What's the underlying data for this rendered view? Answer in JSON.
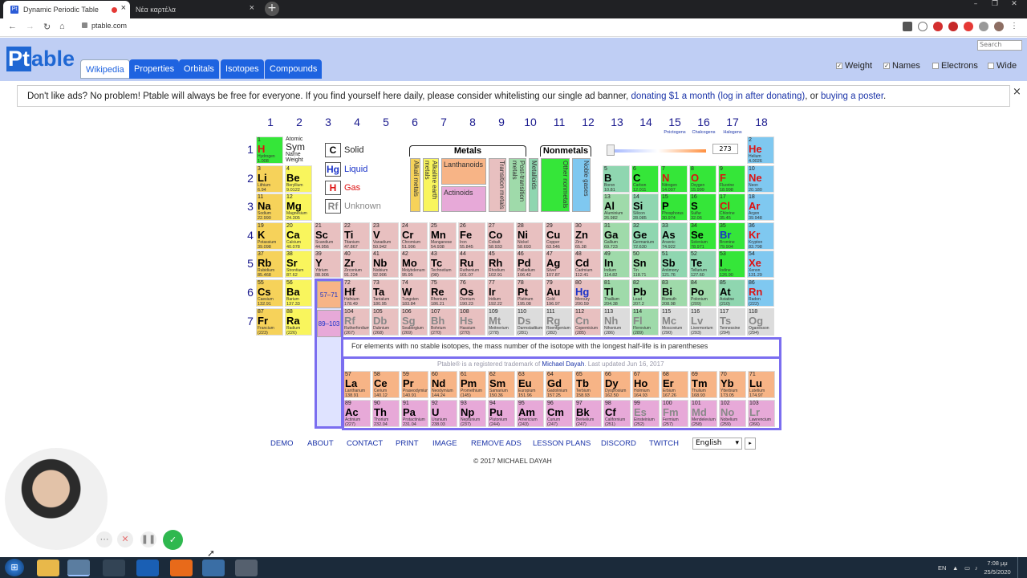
{
  "browser": {
    "tab_title": "Dynamic Periodic Table",
    "tab2_title": "Νέα καρτέλα",
    "url": "ptable.com",
    "tab_close": "×",
    "new_tab": "+"
  },
  "site": {
    "logo_pt": "Pt",
    "logo_rest": "able",
    "search_placeholder": "Search",
    "tabs": [
      "Wikipedia",
      "Properties",
      "Orbitals",
      "Isotopes",
      "Compounds"
    ],
    "options": [
      "Weight",
      "Names",
      "Electrons",
      "Wide"
    ],
    "ad_text": "Don't like ads? No problem! Ptable will always be free for everyone. If you find yourself here daily, please consider whitelisting our single ad banner, ",
    "ad_link1": "donating $1 a month",
    "ad_link2": "(log in after donating)",
    "ad_mid": ", or ",
    "ad_link3": "buying a poster",
    "ad_end": ".",
    "ad_close": "×"
  },
  "groups": [
    "1",
    "2",
    "3",
    "4",
    "5",
    "6",
    "7",
    "8",
    "9",
    "10",
    "11",
    "12",
    "13",
    "14",
    "15",
    "16",
    "17",
    "18"
  ],
  "group_sub": {
    "15": "Pnictogens",
    "16": "Chalcogens",
    "17": "Halogens"
  },
  "periods": [
    "1",
    "2",
    "3",
    "4",
    "5",
    "6",
    "7"
  ],
  "legend": {
    "atomic": "Atomic",
    "sym": "Sym",
    "name": "Name",
    "weight": "Weight",
    "states": [
      {
        "sym": "C",
        "label": "Solid"
      },
      {
        "sym": "Hg",
        "label": "Liquid"
      },
      {
        "sym": "H",
        "label": "Gas"
      },
      {
        "sym": "Rf",
        "label": "Unknown"
      }
    ],
    "metals": "Metals",
    "nonmetals": "Nonmetals",
    "cats": [
      "Alkali metals",
      "Alkaline earth metals",
      "Lanthanoids",
      "Actinoids",
      "Transition metals",
      "Post-transition metals",
      "Metalloids",
      "Other nonmetals",
      "Noble gases"
    ],
    "slider_value": "273"
  },
  "placeholders": {
    "la": "57–71",
    "ac": "89–103"
  },
  "elements": [
    [
      1,
      "H",
      "Hydrogen",
      "1.008",
      1,
      1,
      "nm2",
      "gas"
    ],
    [
      2,
      "He",
      "Helium",
      "4.0026",
      18,
      1,
      "nb",
      "gas"
    ],
    [
      3,
      "Li",
      "Lithium",
      "6.94",
      1,
      2,
      "alk",
      ""
    ],
    [
      4,
      "Be",
      "Beryllium",
      "9.0122",
      2,
      2,
      "ae",
      ""
    ],
    [
      5,
      "B",
      "Boron",
      "10.81",
      13,
      2,
      "md",
      ""
    ],
    [
      6,
      "C",
      "Carbon",
      "12.011",
      14,
      2,
      "nm2",
      ""
    ],
    [
      7,
      "N",
      "Nitrogen",
      "14.007",
      15,
      2,
      "nm2",
      "gas"
    ],
    [
      8,
      "O",
      "Oxygen",
      "15.999",
      16,
      2,
      "nm2",
      "gas"
    ],
    [
      9,
      "F",
      "Fluorine",
      "18.998",
      17,
      2,
      "hal",
      "gas"
    ],
    [
      10,
      "Ne",
      "Neon",
      "20.180",
      18,
      2,
      "nb",
      "gas"
    ],
    [
      11,
      "Na",
      "Sodium",
      "22.990",
      1,
      3,
      "alk",
      ""
    ],
    [
      12,
      "Mg",
      "Magnesium",
      "24.305",
      2,
      3,
      "ae",
      ""
    ],
    [
      13,
      "Al",
      "Aluminium",
      "26.982",
      13,
      3,
      "pt",
      ""
    ],
    [
      14,
      "Si",
      "Silicon",
      "28.085",
      14,
      3,
      "md",
      ""
    ],
    [
      15,
      "P",
      "Phosphorus",
      "30.974",
      15,
      3,
      "nm2",
      ""
    ],
    [
      16,
      "S",
      "Sulfur",
      "32.06",
      16,
      3,
      "nm2",
      ""
    ],
    [
      17,
      "Cl",
      "Chlorine",
      "35.45",
      17,
      3,
      "hal",
      "gas"
    ],
    [
      18,
      "Ar",
      "Argon",
      "39.948",
      18,
      3,
      "nb",
      "gas"
    ],
    [
      19,
      "K",
      "Potassium",
      "39.098",
      1,
      4,
      "alk",
      ""
    ],
    [
      20,
      "Ca",
      "Calcium",
      "40.078",
      2,
      4,
      "ae",
      ""
    ],
    [
      21,
      "Sc",
      "Scandium",
      "44.956",
      3,
      4,
      "tm",
      ""
    ],
    [
      22,
      "Ti",
      "Titanium",
      "47.867",
      4,
      4,
      "tm",
      ""
    ],
    [
      23,
      "V",
      "Vanadium",
      "50.942",
      5,
      4,
      "tm",
      ""
    ],
    [
      24,
      "Cr",
      "Chromium",
      "51.996",
      6,
      4,
      "tm",
      ""
    ],
    [
      25,
      "Mn",
      "Manganese",
      "54.938",
      7,
      4,
      "tm",
      ""
    ],
    [
      26,
      "Fe",
      "Iron",
      "55.845",
      8,
      4,
      "tm",
      ""
    ],
    [
      27,
      "Co",
      "Cobalt",
      "58.933",
      9,
      4,
      "tm",
      ""
    ],
    [
      28,
      "Ni",
      "Nickel",
      "58.693",
      10,
      4,
      "tm",
      ""
    ],
    [
      29,
      "Cu",
      "Copper",
      "63.546",
      11,
      4,
      "tm",
      ""
    ],
    [
      30,
      "Zn",
      "Zinc",
      "65.38",
      12,
      4,
      "tm",
      ""
    ],
    [
      31,
      "Ga",
      "Gallium",
      "69.723",
      13,
      4,
      "pt",
      ""
    ],
    [
      32,
      "Ge",
      "Germanium",
      "72.630",
      14,
      4,
      "md",
      ""
    ],
    [
      33,
      "As",
      "Arsenic",
      "74.922",
      15,
      4,
      "md",
      ""
    ],
    [
      34,
      "Se",
      "Selenium",
      "78.971",
      16,
      4,
      "nm2",
      ""
    ],
    [
      35,
      "Br",
      "Bromine",
      "79.904",
      17,
      4,
      "hal",
      "liq"
    ],
    [
      36,
      "Kr",
      "Krypton",
      "83.798",
      18,
      4,
      "nb",
      "gas"
    ],
    [
      37,
      "Rb",
      "Rubidium",
      "85.468",
      1,
      5,
      "alk",
      ""
    ],
    [
      38,
      "Sr",
      "Strontium",
      "87.62",
      2,
      5,
      "ae",
      ""
    ],
    [
      39,
      "Y",
      "Yttrium",
      "88.906",
      3,
      5,
      "tm",
      ""
    ],
    [
      40,
      "Zr",
      "Zirconium",
      "91.224",
      4,
      5,
      "tm",
      ""
    ],
    [
      41,
      "Nb",
      "Niobium",
      "92.906",
      5,
      5,
      "tm",
      ""
    ],
    [
      42,
      "Mo",
      "Molybdenum",
      "95.95",
      6,
      5,
      "tm",
      ""
    ],
    [
      43,
      "Tc",
      "Technetium",
      "(98)",
      7,
      5,
      "tm",
      ""
    ],
    [
      44,
      "Ru",
      "Ruthenium",
      "101.07",
      8,
      5,
      "tm",
      ""
    ],
    [
      45,
      "Rh",
      "Rhodium",
      "102.91",
      9,
      5,
      "tm",
      ""
    ],
    [
      46,
      "Pd",
      "Palladium",
      "106.42",
      10,
      5,
      "tm",
      ""
    ],
    [
      47,
      "Ag",
      "Silver",
      "107.87",
      11,
      5,
      "tm",
      ""
    ],
    [
      48,
      "Cd",
      "Cadmium",
      "112.41",
      12,
      5,
      "tm",
      ""
    ],
    [
      49,
      "In",
      "Indium",
      "114.82",
      13,
      5,
      "pt",
      ""
    ],
    [
      50,
      "Sn",
      "Tin",
      "118.71",
      14,
      5,
      "pt",
      ""
    ],
    [
      51,
      "Sb",
      "Antimony",
      "121.76",
      15,
      5,
      "md",
      ""
    ],
    [
      52,
      "Te",
      "Tellurium",
      "127.60",
      16,
      5,
      "md",
      ""
    ],
    [
      53,
      "I",
      "Iodine",
      "126.90",
      17,
      5,
      "hal",
      ""
    ],
    [
      54,
      "Xe",
      "Xenon",
      "131.29",
      18,
      5,
      "nb",
      "gas"
    ],
    [
      55,
      "Cs",
      "Caesium",
      "132.91",
      1,
      6,
      "alk",
      ""
    ],
    [
      56,
      "Ba",
      "Barium",
      "137.33",
      2,
      6,
      "ae",
      ""
    ],
    [
      72,
      "Hf",
      "Hafnium",
      "178.49",
      4,
      6,
      "tm",
      ""
    ],
    [
      73,
      "Ta",
      "Tantalum",
      "180.95",
      5,
      6,
      "tm",
      ""
    ],
    [
      74,
      "W",
      "Tungsten",
      "183.84",
      6,
      6,
      "tm",
      ""
    ],
    [
      75,
      "Re",
      "Rhenium",
      "186.21",
      7,
      6,
      "tm",
      ""
    ],
    [
      76,
      "Os",
      "Osmium",
      "190.23",
      8,
      6,
      "tm",
      ""
    ],
    [
      77,
      "Ir",
      "Iridium",
      "192.22",
      9,
      6,
      "tm",
      ""
    ],
    [
      78,
      "Pt",
      "Platinum",
      "195.08",
      10,
      6,
      "tm",
      ""
    ],
    [
      79,
      "Au",
      "Gold",
      "196.97",
      11,
      6,
      "tm",
      ""
    ],
    [
      80,
      "Hg",
      "Mercury",
      "200.59",
      12,
      6,
      "tm",
      "liq"
    ],
    [
      81,
      "Tl",
      "Thallium",
      "204.38",
      13,
      6,
      "pt",
      ""
    ],
    [
      82,
      "Pb",
      "Lead",
      "207.2",
      14,
      6,
      "pt",
      ""
    ],
    [
      83,
      "Bi",
      "Bismuth",
      "208.98",
      15,
      6,
      "pt",
      ""
    ],
    [
      84,
      "Po",
      "Polonium",
      "(209)",
      16,
      6,
      "pt",
      ""
    ],
    [
      85,
      "At",
      "Astatine",
      "(210)",
      17,
      6,
      "md",
      ""
    ],
    [
      86,
      "Rn",
      "Radon",
      "(222)",
      18,
      6,
      "nb",
      "gas"
    ],
    [
      87,
      "Fr",
      "Francium",
      "(223)",
      1,
      7,
      "alk",
      ""
    ],
    [
      88,
      "Ra",
      "Radium",
      "(226)",
      2,
      7,
      "ae",
      ""
    ],
    [
      104,
      "Rf",
      "Rutherfordium",
      "(267)",
      4,
      7,
      "tm",
      "unk"
    ],
    [
      105,
      "Db",
      "Dubnium",
      "(268)",
      5,
      7,
      "tm",
      "unk"
    ],
    [
      106,
      "Sg",
      "Seaborgium",
      "(269)",
      6,
      7,
      "tm",
      "unk"
    ],
    [
      107,
      "Bh",
      "Bohrium",
      "(270)",
      7,
      7,
      "tm",
      "unk"
    ],
    [
      108,
      "Hs",
      "Hassium",
      "(270)",
      8,
      7,
      "tm",
      "unk"
    ],
    [
      109,
      "Mt",
      "Meitnerium",
      "(278)",
      9,
      7,
      "unkc",
      "unk"
    ],
    [
      110,
      "Ds",
      "Darmstadtium",
      "(281)",
      10,
      7,
      "unkc",
      "unk"
    ],
    [
      111,
      "Rg",
      "Roentgenium",
      "(282)",
      11,
      7,
      "unkc",
      "unk"
    ],
    [
      112,
      "Cn",
      "Copernicium",
      "(285)",
      12,
      7,
      "tm",
      "unk"
    ],
    [
      113,
      "Nh",
      "Nihonium",
      "(286)",
      13,
      7,
      "unkc",
      "unk"
    ],
    [
      114,
      "Fl",
      "Flerovium",
      "(289)",
      14,
      7,
      "pt",
      "unk"
    ],
    [
      115,
      "Mc",
      "Moscovium",
      "(290)",
      15,
      7,
      "unkc",
      "unk"
    ],
    [
      116,
      "Lv",
      "Livermorium",
      "(293)",
      16,
      7,
      "unkc",
      "unk"
    ],
    [
      117,
      "Ts",
      "Tennessine",
      "(294)",
      17,
      7,
      "unkc",
      "unk"
    ],
    [
      118,
      "Og",
      "Oganesson",
      "(294)",
      18,
      7,
      "unkc",
      "unk"
    ]
  ],
  "lanthanides": [
    [
      57,
      "La",
      "Lanthanum",
      "138.91"
    ],
    [
      58,
      "Ce",
      "Cerium",
      "140.12"
    ],
    [
      59,
      "Pr",
      "Praseodymium",
      "140.91"
    ],
    [
      60,
      "Nd",
      "Neodymium",
      "144.24"
    ],
    [
      61,
      "Pm",
      "Promethium",
      "(145)"
    ],
    [
      62,
      "Sm",
      "Samarium",
      "150.36"
    ],
    [
      63,
      "Eu",
      "Europium",
      "151.96"
    ],
    [
      64,
      "Gd",
      "Gadolinium",
      "157.25"
    ],
    [
      65,
      "Tb",
      "Terbium",
      "158.93"
    ],
    [
      66,
      "Dy",
      "Dysprosium",
      "162.50"
    ],
    [
      67,
      "Ho",
      "Holmium",
      "164.93"
    ],
    [
      68,
      "Er",
      "Erbium",
      "167.26"
    ],
    [
      69,
      "Tm",
      "Thulium",
      "168.93"
    ],
    [
      70,
      "Yb",
      "Ytterbium",
      "173.05"
    ],
    [
      71,
      "Lu",
      "Lutetium",
      "174.97"
    ]
  ],
  "actinides": [
    [
      89,
      "Ac",
      "Actinium",
      "(227)"
    ],
    [
      90,
      "Th",
      "Thorium",
      "232.04"
    ],
    [
      91,
      "Pa",
      "Protactinium",
      "231.04"
    ],
    [
      92,
      "U",
      "Uranium",
      "238.03"
    ],
    [
      93,
      "Np",
      "Neptunium",
      "(237)"
    ],
    [
      94,
      "Pu",
      "Plutonium",
      "(244)"
    ],
    [
      95,
      "Am",
      "Americium",
      "(243)"
    ],
    [
      96,
      "Cm",
      "Curium",
      "(247)"
    ],
    [
      97,
      "Bk",
      "Berkelium",
      "(247)"
    ],
    [
      98,
      "Cf",
      "Californium",
      "(251)"
    ],
    [
      99,
      "Es",
      "Einsteinium",
      "(252)"
    ],
    [
      100,
      "Fm",
      "Fermium",
      "(257)"
    ],
    [
      101,
      "Md",
      "Mendelevium",
      "(258)"
    ],
    [
      102,
      "No",
      "Nobelium",
      "(259)"
    ],
    [
      103,
      "Lr",
      "Lawrencium",
      "(266)"
    ]
  ],
  "note": "For elements with no stable isotopes, the mass number of the isotope with the longest half-life is in parentheses",
  "trademark_pre": "Ptable® is a registered trademark of ",
  "trademark_name": "Michael Dayah",
  "trademark_post": ". Last updated Jun 16, 2017",
  "footer": {
    "links": [
      "DEMO",
      "ABOUT",
      "CONTACT",
      "PRINT",
      "IMAGE",
      "REMOVE ADS",
      "LESSON PLANS",
      "DISCORD",
      "TWITCH"
    ],
    "language": "English",
    "copyright": "© 2017 MICHAEL DAYAH"
  },
  "taskbar": {
    "lang": "EN",
    "time": "7:08 μμ",
    "date": "25/5/2020"
  },
  "colors": {
    "accent": "#1e63e0",
    "header_bg": "#bfcef4",
    "anchor": "#7b6ef0"
  }
}
